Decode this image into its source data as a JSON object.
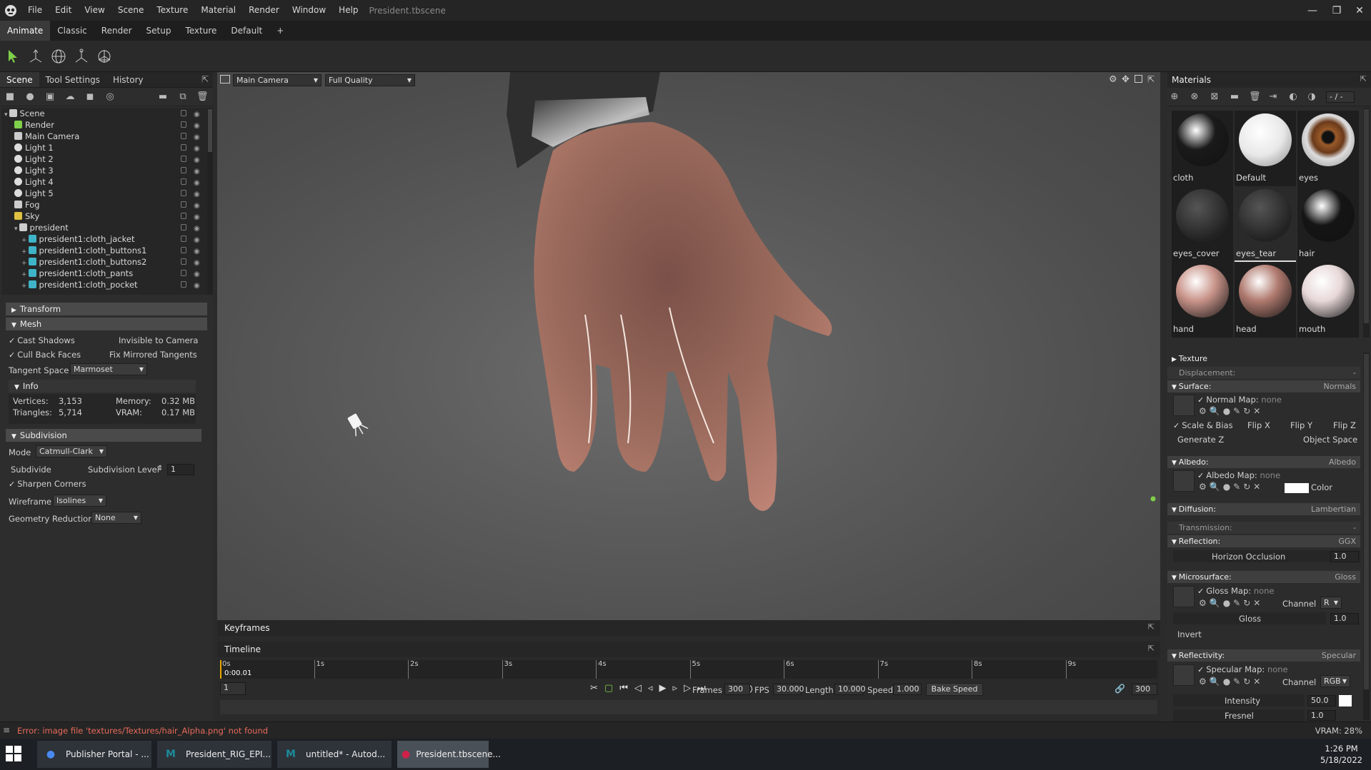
{
  "menu": {
    "items": [
      "File",
      "Edit",
      "View",
      "Scene",
      "Texture",
      "Material",
      "Render",
      "Window",
      "Help"
    ],
    "doc_title": "President.tbscene"
  },
  "window_controls": {
    "minimize": "—",
    "maximize": "❐",
    "close": "✕"
  },
  "workspace_tabs": [
    "Animate",
    "Classic",
    "Render",
    "Setup",
    "Texture",
    "Default",
    "+"
  ],
  "left_tabs": [
    "Scene",
    "Tool Settings",
    "History"
  ],
  "scene_tree": [
    {
      "label": "Scene",
      "icon": "scene-icon"
    },
    {
      "label": "Render",
      "icon": "render-icon"
    },
    {
      "label": "Main Camera",
      "icon": "camera-icon"
    },
    {
      "label": "Light 1",
      "icon": "light-icon"
    },
    {
      "label": "Light 2",
      "icon": "light-icon"
    },
    {
      "label": "Light 3",
      "icon": "light-icon"
    },
    {
      "label": "Light 4",
      "icon": "light-icon"
    },
    {
      "label": "Light 5",
      "icon": "light-icon"
    },
    {
      "label": "Fog",
      "icon": "fog-icon"
    },
    {
      "label": "Sky",
      "icon": "sky-icon"
    },
    {
      "label": "president",
      "icon": "group-icon"
    },
    {
      "label": "president1:cloth_jacket",
      "icon": "mesh-icon"
    },
    {
      "label": "president1:cloth_buttons1",
      "icon": "mesh-icon"
    },
    {
      "label": "president1:cloth_buttons2",
      "icon": "mesh-icon"
    },
    {
      "label": "president1:cloth_pants",
      "icon": "mesh-icon"
    },
    {
      "label": "president1:cloth_pocket",
      "icon": "mesh-icon"
    }
  ],
  "props": {
    "transform": "Transform",
    "mesh": "Mesh",
    "cast_shadows": "Cast Shadows",
    "invisible_to_camera": "Invisible to Camera",
    "cull_back_faces": "Cull Back Faces",
    "fix_mirrored": "Fix Mirrored Tangents",
    "tangent_space_label": "Tangent Space",
    "tangent_space_value": "Marmoset",
    "info": "Info",
    "vertices_label": "Vertices:",
    "vertices_value": "3,153",
    "memory_label": "Memory:",
    "memory_value": "0.32 MB",
    "triangles_label": "Triangles:",
    "triangles_value": "5,714",
    "vram_label": "VRAM:",
    "vram_value": "0.17 MB",
    "subdivision": "Subdivision",
    "mode_label": "Mode",
    "mode_value": "Catmull-Clark",
    "subdivide": "Subdivide",
    "subdiv_level_label": "Subdivision Level",
    "subdiv_level_value": "1",
    "sharpen_corners": "Sharpen Corners",
    "wireframe_label": "Wireframe",
    "wireframe_value": "Isolines",
    "geo_reduction_label": "Geometry Reduction",
    "geo_reduction_value": "None"
  },
  "viewport": {
    "camera": "Main Camera",
    "quality": "Full Quality"
  },
  "materials": {
    "title": "Materials",
    "counter": "- / -",
    "items": [
      {
        "name": "cloth",
        "color": "#1a1a1a"
      },
      {
        "name": "Default",
        "color": "#f0f0f0"
      },
      {
        "name": "eyes",
        "color": "#7a4a2a"
      },
      {
        "name": "eyes_cover",
        "color": "#222"
      },
      {
        "name": "eyes_tear",
        "color": "#222"
      },
      {
        "name": "hair",
        "color": "#151515"
      },
      {
        "name": "hand",
        "color": "#c9948a"
      },
      {
        "name": "head",
        "color": "#b07a6f"
      },
      {
        "name": "mouth",
        "color": "#e8d8d8"
      }
    ]
  },
  "mat_props": {
    "texture": "Texture",
    "displacement": "Displacement:",
    "displacement_value": "-",
    "surface": "Surface:",
    "surface_value": "Normals",
    "normal_map": "Normal Map:",
    "none": "none",
    "scale_bias": "Scale & Bias",
    "flip_x": "Flip X",
    "flip_y": "Flip Y",
    "flip_z": "Flip Z",
    "generate_z": "Generate Z",
    "object_space": "Object Space",
    "albedo": "Albedo:",
    "albedo_value": "Albedo",
    "albedo_map": "Albedo Map:",
    "color": "Color",
    "diffusion": "Diffusion:",
    "diffusion_value": "Lambertian",
    "transmission": "Transmission:",
    "transmission_value": "-",
    "reflection": "Reflection:",
    "reflection_value": "GGX",
    "horizon_occlusion": "Horizon Occlusion",
    "horizon_value": "1.0",
    "microsurface": "Microsurface:",
    "microsurface_value": "Gloss",
    "gloss_map": "Gloss Map:",
    "channel": "Channel",
    "channel_r": "R",
    "gloss": "Gloss",
    "gloss_value": "1.0",
    "invert": "Invert",
    "reflectivity": "Reflectivity:",
    "reflectivity_value": "Specular",
    "specular_map": "Specular Map:",
    "channel_rgb": "RGB",
    "intensity": "Intensity",
    "intensity_value": "50.0",
    "fresnel": "Fresnel",
    "fresnel_value": "1.0"
  },
  "timeline": {
    "keyframes": "Keyframes",
    "timeline": "Timeline",
    "current_time": "0:00.01",
    "ticks": [
      "0s",
      "1s",
      "2s",
      "3s",
      "4s",
      "5s",
      "6s",
      "7s",
      "8s",
      "9s"
    ],
    "frame": "1",
    "frames_label": "Frames",
    "frames_value": "300",
    "fps_label": "FPS",
    "fps_value": "30.000",
    "length_label": "Length",
    "length_value": "10.000",
    "speed_label": "Speed",
    "speed_value": "1.000",
    "bake_speed": "Bake Speed",
    "end_frame": "300"
  },
  "status": {
    "error": "Error: image file 'textures/Textures/hair_Alpha.png' not found",
    "vram": "VRAM: 28%"
  },
  "taskbar": {
    "items": [
      {
        "label": "Publisher Portal - ...",
        "icon": "chrome-icon"
      },
      {
        "label": "President_RIG_EPI...",
        "icon": "maya-icon"
      },
      {
        "label": "untitled* - Autod...",
        "icon": "maya-icon"
      },
      {
        "label": "President.tbscene...",
        "icon": "toolbag-icon"
      }
    ],
    "time": "1:26 PM",
    "date": "5/18/2022"
  },
  "colors": {
    "accent_green": "#7fd04a",
    "panel": "#2d2d2d",
    "section": "#4a4a4a"
  }
}
